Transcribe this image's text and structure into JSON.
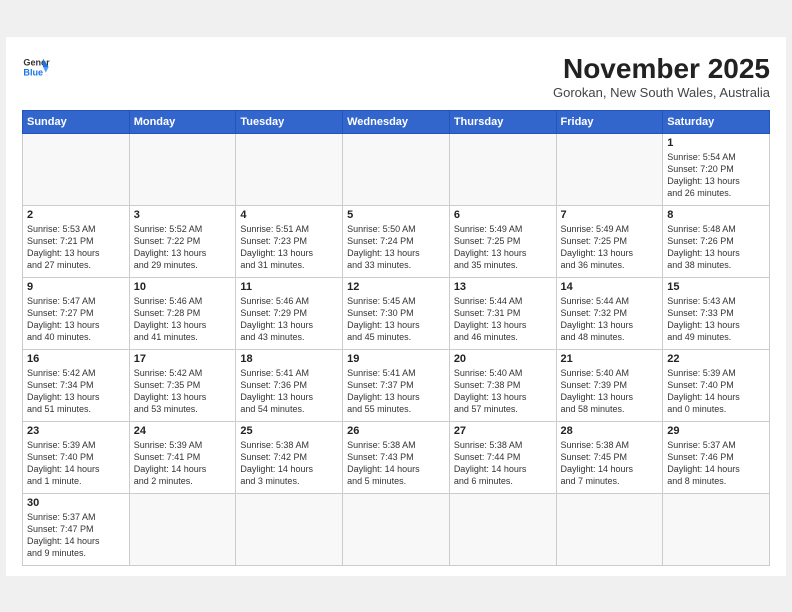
{
  "header": {
    "logo_line1": "General",
    "logo_line2": "Blue",
    "month_title": "November 2025",
    "location": "Gorokan, New South Wales, Australia"
  },
  "weekdays": [
    "Sunday",
    "Monday",
    "Tuesday",
    "Wednesday",
    "Thursday",
    "Friday",
    "Saturday"
  ],
  "weeks": [
    [
      {
        "day": "",
        "info": ""
      },
      {
        "day": "",
        "info": ""
      },
      {
        "day": "",
        "info": ""
      },
      {
        "day": "",
        "info": ""
      },
      {
        "day": "",
        "info": ""
      },
      {
        "day": "",
        "info": ""
      },
      {
        "day": "1",
        "info": "Sunrise: 5:54 AM\nSunset: 7:20 PM\nDaylight: 13 hours\nand 26 minutes."
      }
    ],
    [
      {
        "day": "2",
        "info": "Sunrise: 5:53 AM\nSunset: 7:21 PM\nDaylight: 13 hours\nand 27 minutes."
      },
      {
        "day": "3",
        "info": "Sunrise: 5:52 AM\nSunset: 7:22 PM\nDaylight: 13 hours\nand 29 minutes."
      },
      {
        "day": "4",
        "info": "Sunrise: 5:51 AM\nSunset: 7:23 PM\nDaylight: 13 hours\nand 31 minutes."
      },
      {
        "day": "5",
        "info": "Sunrise: 5:50 AM\nSunset: 7:24 PM\nDaylight: 13 hours\nand 33 minutes."
      },
      {
        "day": "6",
        "info": "Sunrise: 5:49 AM\nSunset: 7:25 PM\nDaylight: 13 hours\nand 35 minutes."
      },
      {
        "day": "7",
        "info": "Sunrise: 5:49 AM\nSunset: 7:25 PM\nDaylight: 13 hours\nand 36 minutes."
      },
      {
        "day": "8",
        "info": "Sunrise: 5:48 AM\nSunset: 7:26 PM\nDaylight: 13 hours\nand 38 minutes."
      }
    ],
    [
      {
        "day": "9",
        "info": "Sunrise: 5:47 AM\nSunset: 7:27 PM\nDaylight: 13 hours\nand 40 minutes."
      },
      {
        "day": "10",
        "info": "Sunrise: 5:46 AM\nSunset: 7:28 PM\nDaylight: 13 hours\nand 41 minutes."
      },
      {
        "day": "11",
        "info": "Sunrise: 5:46 AM\nSunset: 7:29 PM\nDaylight: 13 hours\nand 43 minutes."
      },
      {
        "day": "12",
        "info": "Sunrise: 5:45 AM\nSunset: 7:30 PM\nDaylight: 13 hours\nand 45 minutes."
      },
      {
        "day": "13",
        "info": "Sunrise: 5:44 AM\nSunset: 7:31 PM\nDaylight: 13 hours\nand 46 minutes."
      },
      {
        "day": "14",
        "info": "Sunrise: 5:44 AM\nSunset: 7:32 PM\nDaylight: 13 hours\nand 48 minutes."
      },
      {
        "day": "15",
        "info": "Sunrise: 5:43 AM\nSunset: 7:33 PM\nDaylight: 13 hours\nand 49 minutes."
      }
    ],
    [
      {
        "day": "16",
        "info": "Sunrise: 5:42 AM\nSunset: 7:34 PM\nDaylight: 13 hours\nand 51 minutes."
      },
      {
        "day": "17",
        "info": "Sunrise: 5:42 AM\nSunset: 7:35 PM\nDaylight: 13 hours\nand 53 minutes."
      },
      {
        "day": "18",
        "info": "Sunrise: 5:41 AM\nSunset: 7:36 PM\nDaylight: 13 hours\nand 54 minutes."
      },
      {
        "day": "19",
        "info": "Sunrise: 5:41 AM\nSunset: 7:37 PM\nDaylight: 13 hours\nand 55 minutes."
      },
      {
        "day": "20",
        "info": "Sunrise: 5:40 AM\nSunset: 7:38 PM\nDaylight: 13 hours\nand 57 minutes."
      },
      {
        "day": "21",
        "info": "Sunrise: 5:40 AM\nSunset: 7:39 PM\nDaylight: 13 hours\nand 58 minutes."
      },
      {
        "day": "22",
        "info": "Sunrise: 5:39 AM\nSunset: 7:40 PM\nDaylight: 14 hours\nand 0 minutes."
      }
    ],
    [
      {
        "day": "23",
        "info": "Sunrise: 5:39 AM\nSunset: 7:40 PM\nDaylight: 14 hours\nand 1 minute."
      },
      {
        "day": "24",
        "info": "Sunrise: 5:39 AM\nSunset: 7:41 PM\nDaylight: 14 hours\nand 2 minutes."
      },
      {
        "day": "25",
        "info": "Sunrise: 5:38 AM\nSunset: 7:42 PM\nDaylight: 14 hours\nand 3 minutes."
      },
      {
        "day": "26",
        "info": "Sunrise: 5:38 AM\nSunset: 7:43 PM\nDaylight: 14 hours\nand 5 minutes."
      },
      {
        "day": "27",
        "info": "Sunrise: 5:38 AM\nSunset: 7:44 PM\nDaylight: 14 hours\nand 6 minutes."
      },
      {
        "day": "28",
        "info": "Sunrise: 5:38 AM\nSunset: 7:45 PM\nDaylight: 14 hours\nand 7 minutes."
      },
      {
        "day": "29",
        "info": "Sunrise: 5:37 AM\nSunset: 7:46 PM\nDaylight: 14 hours\nand 8 minutes."
      }
    ],
    [
      {
        "day": "30",
        "info": "Sunrise: 5:37 AM\nSunset: 7:47 PM\nDaylight: 14 hours\nand 9 minutes."
      },
      {
        "day": "",
        "info": ""
      },
      {
        "day": "",
        "info": ""
      },
      {
        "day": "",
        "info": ""
      },
      {
        "day": "",
        "info": ""
      },
      {
        "day": "",
        "info": ""
      },
      {
        "day": "",
        "info": ""
      }
    ]
  ]
}
